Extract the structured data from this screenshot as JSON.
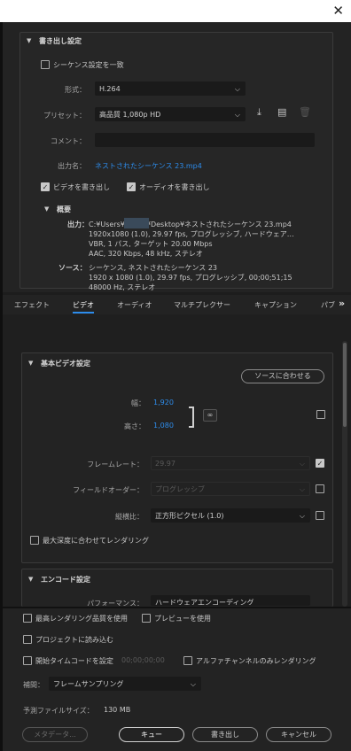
{
  "window": {
    "close_glyph": "✕"
  },
  "export_settings": {
    "header": "書き出し設定",
    "match_sequence_label": "シーケンス設定を一致",
    "match_sequence_checked": false,
    "format_label": "形式：",
    "format_value": "H.264",
    "preset_label": "プリセット：",
    "preset_value": "高品質 1,080p HD",
    "comment_label": "コメント：",
    "comment_value": "",
    "output_name_label": "出力名：",
    "output_name_value": "ネストされたシーケンス 23.mp4",
    "export_video_label": "ビデオを書き出し",
    "export_video_checked": true,
    "export_audio_label": "オーディオを書き出し",
    "export_audio_checked": true
  },
  "summary": {
    "header": "概要",
    "output_label": "出力：",
    "output_lines": [
      "C:¥Users¥　　　¥Desktop¥ネストされたシーケンス 23.mp4",
      "1920x1080 (1.0), 29.97 fps, プログレッシブ, ハードウェア…",
      "VBR, 1 パス, ターゲット 20.00 Mbps",
      "AAC, 320 Kbps, 48 kHz, ステレオ"
    ],
    "source_label": "ソース：",
    "source_lines": [
      "シーケンス, ネストされたシーケンス 23",
      "1920 x 1080 (1.0), 29.97 fps, プログレッシブ, 00;00;51;15",
      "48000 Hz, ステレオ"
    ]
  },
  "tabs": {
    "items": [
      "エフェクト",
      "ビデオ",
      "オーディオ",
      "マルチプレクサー",
      "キャプション",
      "パブ"
    ],
    "active": "ビデオ",
    "more_glyph": "»"
  },
  "basic_video": {
    "header": "基本ビデオ設定",
    "match_source_button": "ソースに合わせる",
    "width_label": "幅：",
    "width_value": "1,920",
    "height_label": "高さ：",
    "height_value": "1,080",
    "frame_rate_label": "フレームレート：",
    "frame_rate_value": "29.97",
    "frame_rate_checked": true,
    "field_order_label": "フィールドオーダー：",
    "field_order_value": "プログレッシブ",
    "field_order_checked": false,
    "aspect_label": "縦横比：",
    "aspect_value": "正方形ピクセル (1.0)",
    "aspect_checked": false,
    "max_depth_label": "最大深度に合わせてレンダリング",
    "max_depth_checked": false
  },
  "encode": {
    "header": "エンコード設定",
    "performance_label": "パフォーマンス：",
    "performance_value": "ハードウェアエンコーディング"
  },
  "bottom": {
    "max_render_quality_label": "最高レンダリング品質を使用",
    "use_preview_label": "プレビューを使用",
    "import_project_label": "プロジェクトに読み込む",
    "set_start_timecode_label": "開始タイムコードを設定",
    "start_timecode_value": "00;00;00;00",
    "alpha_only_label": "アルファチャンネルのみレンダリング",
    "interpolation_label": "補間：",
    "interpolation_value": "フレームサンプリング",
    "file_size_label": "予測ファイルサイズ：",
    "file_size_value": "130 MB",
    "metadata_button": "メタデータ...",
    "queue_button": "キュー",
    "export_button": "書き出し",
    "cancel_button": "キャンセル"
  },
  "colors": {
    "accent": "#2d8ceb",
    "background": "#1d1d1d",
    "panel": "#232323"
  }
}
